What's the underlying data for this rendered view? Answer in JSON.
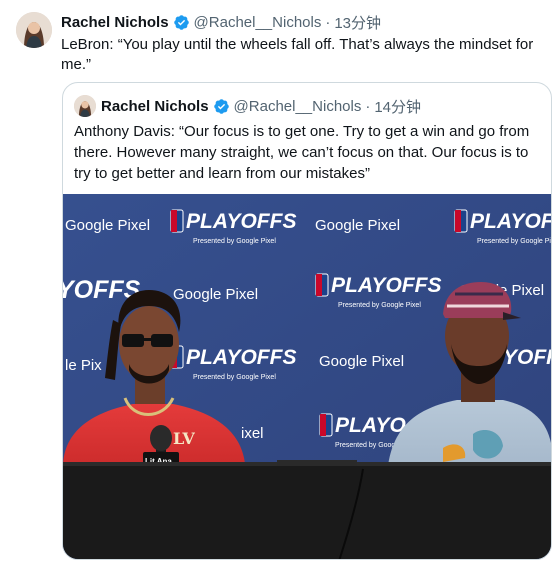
{
  "tweet": {
    "author_name": "Rachel Nichols",
    "handle": "@Rachel__Nichols",
    "separator": "·",
    "time": "13分钟",
    "text": "LeBron: “You play until the wheels fall off. That’s always the mindset for me.”",
    "avatar_icon": "profile-photo",
    "verified_icon": "verified-badge-icon"
  },
  "quoted": {
    "author_name": "Rachel Nichols",
    "handle": "@Rachel__Nichols",
    "separator": "·",
    "time": "14分钟",
    "text": "Anthony Davis: “Our focus is to get one. Try to get a win and go from there. However many straight, we can’t focus on that. Our focus is to try to get better and learn from our mistakes”",
    "media": {
      "backdrop_logos": [
        "PLAYOFFS",
        "Google Pixel",
        "Presented by Google Pixel"
      ],
      "shirt_letters": "LV",
      "mic_label": "Lit Ana"
    }
  },
  "colors": {
    "verified": "#1d9bf0",
    "text": "#0f1419",
    "meta": "#536471",
    "border": "#cfd9de",
    "backdrop": "#3a4f8f"
  }
}
